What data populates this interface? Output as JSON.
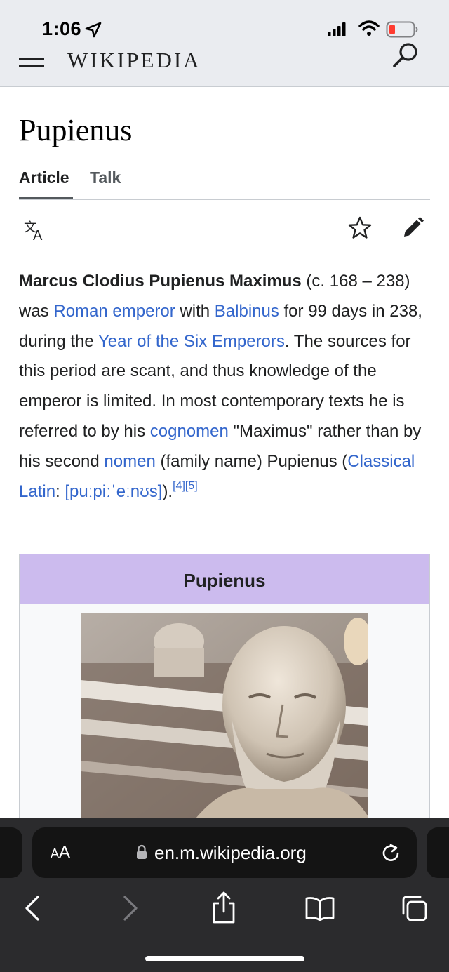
{
  "status_bar": {
    "time": "1:06",
    "battery_color": "#ff3b30"
  },
  "header": {
    "wordmark": "WIKIPEDIA",
    "menu_icon": "hamburger-icon",
    "search_icon": "search-icon"
  },
  "page": {
    "title": "Pupienus",
    "tabs": [
      {
        "label": "Article",
        "selected": true
      },
      {
        "label": "Talk",
        "selected": false
      }
    ],
    "actions": [
      "language-icon",
      "watch-star-icon",
      "edit-pencil-icon"
    ]
  },
  "lead": {
    "bold_name": "Marcus Clodius Pupienus Maximus",
    "t1": " (c. 168 – 238) was ",
    "link_roman_emperor": "Roman emperor",
    "t2": " with ",
    "link_balbinus": "Balbinus",
    "t3": " for 99 days in 238, during the ",
    "link_year_six_emperors": "Year of the Six Emperors",
    "t4": ". The sources for this period are scant, and thus knowledge of the emperor is limited. In most contemporary texts he is referred to by his ",
    "link_cognomen": "cognomen",
    "t5": " \"Maximus\" rather than by his second ",
    "link_nomen": "nomen",
    "t6": " (family name) Pupienus (",
    "link_classical_latin": "Classical Latin",
    "t7": ": ",
    "link_ipa": "[puːpiːˈeːnʊs]",
    "t8": ").",
    "ref1": "[4]",
    "ref2": "[5]"
  },
  "infobox": {
    "title": "Pupienus",
    "header_color": "#ccbbee"
  },
  "safari": {
    "aa_small": "A",
    "aa_large": "A",
    "url": "en.m.wikipedia.org",
    "icons": [
      "back-icon",
      "forward-icon",
      "share-icon",
      "bookmarks-icon",
      "tabs-icon"
    ]
  }
}
